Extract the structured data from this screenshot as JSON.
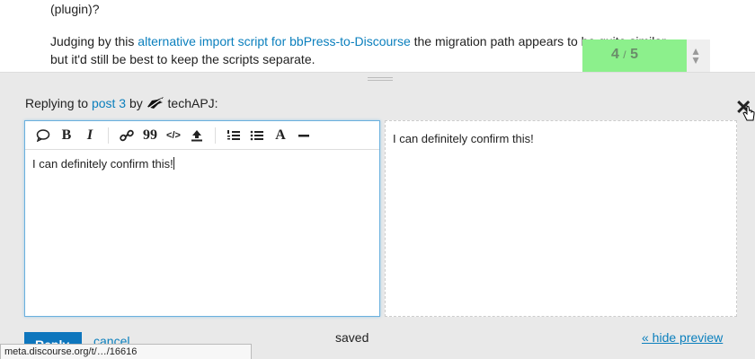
{
  "post": {
    "line_prev": "(plugin)?",
    "p_before_link": "Judging by this ",
    "link": "alternative import script for bbPress-to-Discourse",
    "p_after_link": " the migration path appears to be quite similar,",
    "p_line2": "but it'd still be best to keep the scripts separate."
  },
  "progress": {
    "current": "4",
    "separator": "/",
    "total": "5",
    "fraction": 0.82
  },
  "composer": {
    "replying_prefix": "Replying to ",
    "post_link": "post 3",
    "by": " by ",
    "username": "techAPJ:",
    "close_glyph": "✕",
    "editor_text": "I can definitely confirm this!",
    "preview_text": "I can definitely confirm this!",
    "reply_label": "Reply",
    "cancel_label": "cancel",
    "saved_label": "saved",
    "hide_preview_label": "« hide preview",
    "toolbar": {
      "bold": "B",
      "italic": "I",
      "quote": "99",
      "code": "</>",
      "heading": "A"
    }
  },
  "status_url": "meta.discourse.org/t/…/16616"
}
